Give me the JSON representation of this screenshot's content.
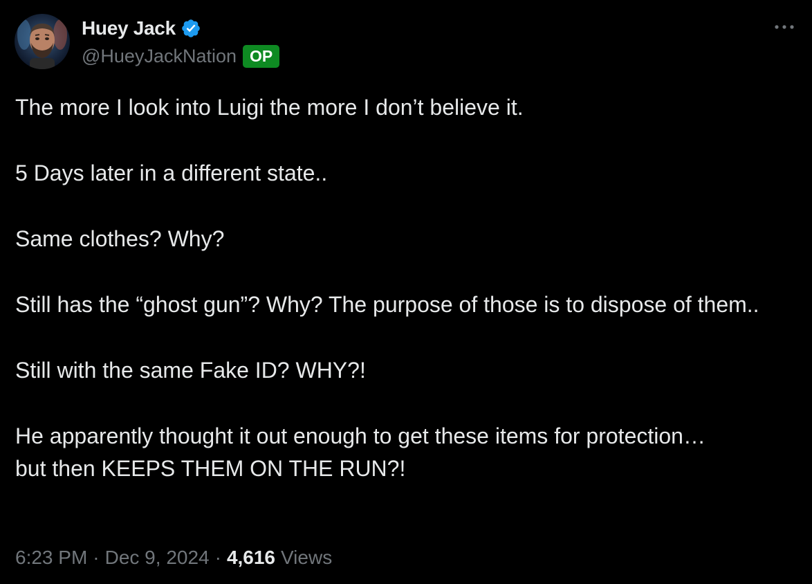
{
  "author": {
    "display_name": "Huey Jack",
    "handle": "@HueyJackNation",
    "badge": "OP",
    "verified": true
  },
  "tweet": {
    "paragraphs": [
      "The more I look into Luigi the more I don’t believe it.",
      "5 Days later in a different state..",
      "Same clothes? Why?",
      "Still has the “ghost gun”? Why? The purpose of those is to dispose of them..",
      "Still with the same Fake ID? WHY?!",
      "He apparently thought it out enough to get these items for protection…\nbut then KEEPS THEM ON THE RUN?!"
    ],
    "time": "6:23 PM",
    "date": "Dec 9, 2024",
    "separator": "·",
    "views_count": "4,616",
    "views_label": "Views"
  },
  "colors": {
    "background": "#000000",
    "text_primary": "#e7e9ea",
    "text_secondary": "#71767b",
    "verified_blue": "#1d9bf0",
    "op_badge_green": "#0e8a22"
  },
  "icons": {
    "verified": "verified-badge-icon",
    "more": "more-options-icon"
  }
}
